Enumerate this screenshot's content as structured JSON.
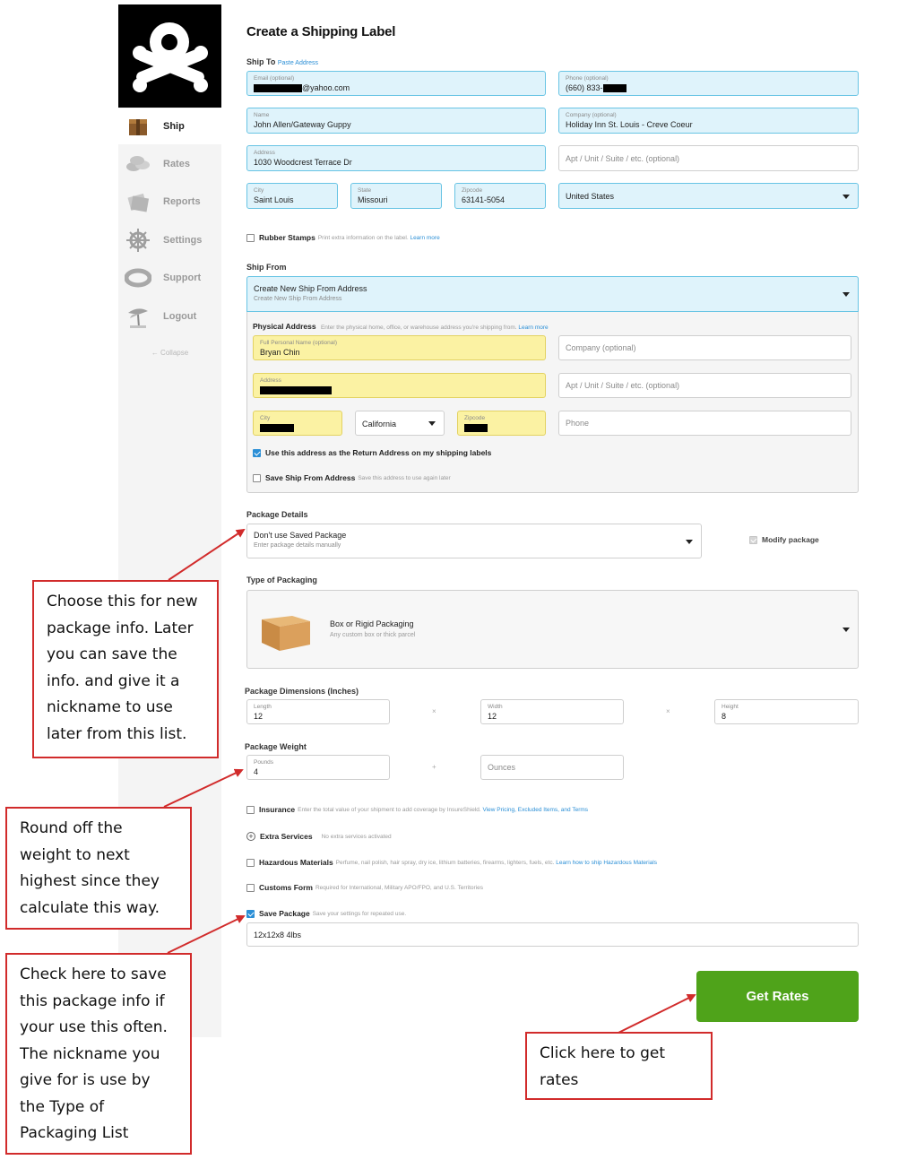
{
  "sidebar": {
    "items": [
      {
        "label": "Ship",
        "icon": "box-icon",
        "active": true
      },
      {
        "label": "Rates",
        "icon": "coins-icon"
      },
      {
        "label": "Reports",
        "icon": "report-icon"
      },
      {
        "label": "Settings",
        "icon": "ships-wheel-icon"
      },
      {
        "label": "Support",
        "icon": "life-ring-icon"
      },
      {
        "label": "Logout",
        "icon": "palm-tree-icon"
      }
    ],
    "collapse": "← Collapse"
  },
  "form": {
    "title": "Create a Shipping Label",
    "ship_to": {
      "heading": "Ship To",
      "paste_link": "Paste Address",
      "email": {
        "label": "Email (optional)",
        "value": "@yahoo.com"
      },
      "phone": {
        "label": "Phone (optional)",
        "value": "(660) 833-"
      },
      "name": {
        "label": "Name",
        "value": "John Allen/Gateway Guppy"
      },
      "company": {
        "label": "Company (optional)",
        "value": "Holiday Inn St. Louis - Creve Coeur"
      },
      "address": {
        "label": "Address",
        "value": "1030 Woodcrest Terrace Dr"
      },
      "apt_placeholder": "Apt / Unit / Suite / etc. (optional)",
      "city": {
        "label": "City",
        "value": "Saint Louis"
      },
      "state": {
        "label": "State",
        "value": "Missouri"
      },
      "zip": {
        "label": "Zipcode",
        "value": "63141-5054"
      },
      "country": "United States"
    },
    "rubber_stamps": {
      "label": "Rubber Stamps",
      "hint": "Print extra information on the label.",
      "link": "Learn more"
    },
    "ship_from": {
      "heading": "Ship From",
      "select_title": "Create New Ship From Address",
      "select_sub": "Create New Ship From Address",
      "physical_label": "Physical Address",
      "physical_hint": "Enter the physical home, office, or warehouse address you're shipping from.",
      "physical_link": "Learn more",
      "full_name": {
        "label": "Full Personal Name (optional)",
        "value": "Bryan Chin"
      },
      "company_placeholder": "Company (optional)",
      "address_label": "Address",
      "apt_placeholder": "Apt / Unit / Suite / etc. (optional)",
      "city_label": "City",
      "state": "California",
      "zip_label": "Zipcode",
      "phone_placeholder": "Phone",
      "return_address": "Use this address as the Return Address on my shipping labels",
      "save_label": "Save Ship From Address",
      "save_hint": "Save this address to use again later"
    },
    "package_details": {
      "heading": "Package Details",
      "select_title": "Don't use Saved Package",
      "select_sub": "Enter package details manually",
      "modify": "Modify package"
    },
    "packaging": {
      "heading": "Type of Packaging",
      "title": "Box or Rigid Packaging",
      "sub": "Any custom box or thick parcel"
    },
    "dimensions": {
      "heading": "Package Dimensions (Inches)",
      "length": {
        "label": "Length",
        "value": "12"
      },
      "width": {
        "label": "Width",
        "value": "12"
      },
      "height": {
        "label": "Height",
        "value": "8"
      },
      "times": "×"
    },
    "weight": {
      "heading": "Package Weight",
      "pounds": {
        "label": "Pounds",
        "value": "4"
      },
      "plus": "+",
      "ounces_placeholder": "Ounces"
    },
    "insurance": {
      "label": "Insurance",
      "hint": "Enter the total value of your shipment to add coverage by InsureShield.",
      "link": "View Pricing, Excluded Items, and Terms"
    },
    "extra_services": {
      "label": "Extra Services",
      "hint": "No extra services activated"
    },
    "hazardous": {
      "label": "Hazardous Materials",
      "hint": "Perfume, nail polish, hair spray, dry ice, lithium batteries, firearms, lighters, fuels, etc.",
      "link": "Learn how to ship Hazardous Materials"
    },
    "customs": {
      "label": "Customs Form",
      "hint": "Required for International, Military APO/FPO, and U.S. Territories"
    },
    "save_package": {
      "label": "Save Package",
      "hint": "Save your settings for repeated use.",
      "nickname": "12x12x8 4lbs"
    },
    "get_rates": "Get Rates"
  },
  "callouts": {
    "saved_package": "Choose this for new package info. Later you can save the info. and give it a nickname to use later from this list.",
    "weight": "Round off the weight to next highest since they calculate this way.",
    "save_package": "Check here to save this package info if your use this often. The nickname you give for is use by the Type of Packaging List",
    "get_rates": "Click here to get rates"
  },
  "colors": {
    "accent": "#2b8fd6",
    "button": "#4fa31a",
    "callout_border": "#d12b2b",
    "ship_to_fill": "#dff3fb",
    "ship_from_fill": "#fbf2a3"
  }
}
